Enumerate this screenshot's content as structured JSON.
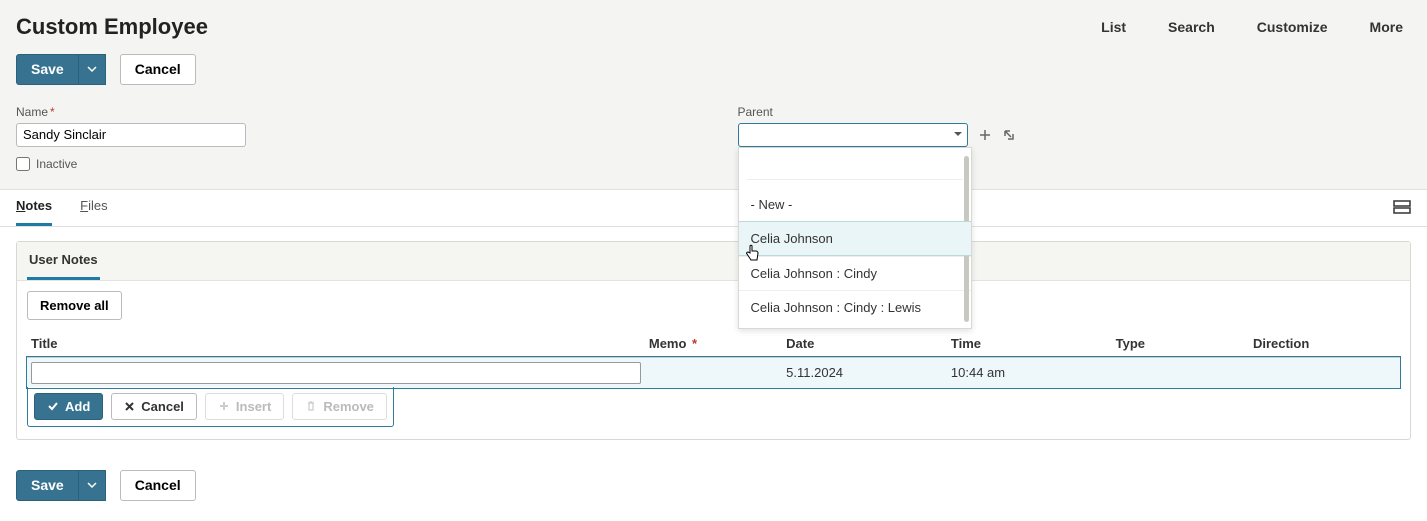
{
  "header": {
    "title": "Custom Employee",
    "topLinks": [
      "List",
      "Search",
      "Customize",
      "More"
    ]
  },
  "actions": {
    "save": "Save",
    "cancel": "Cancel"
  },
  "fields": {
    "name": {
      "label": "Name",
      "required": true,
      "value": "Sandy Sinclair"
    },
    "inactive": {
      "label": "Inactive",
      "checked": false
    },
    "parent": {
      "label": "Parent",
      "value": "",
      "options": [
        "- New -",
        "Celia Johnson",
        "Celia Johnson : Cindy",
        "Celia Johnson : Cindy : Lewis"
      ],
      "highlightIndex": 1
    }
  },
  "tabs": {
    "items": [
      {
        "label": "Notes",
        "underline": "N",
        "active": true
      },
      {
        "label": "Files",
        "underline": "F",
        "active": false
      }
    ]
  },
  "notes": {
    "subtab": "User Notes",
    "removeAll": "Remove all",
    "columns": {
      "title": "Title",
      "memo": "Memo",
      "memoRequired": true,
      "date": "Date",
      "time": "Time",
      "type": "Type",
      "direction": "Direction"
    },
    "row": {
      "title": "",
      "memo": "",
      "date": "5.11.2024",
      "time": "10:44 am",
      "type": "",
      "direction": ""
    },
    "rowActions": {
      "add": "Add",
      "cancel": "Cancel",
      "insert": "Insert",
      "remove": "Remove"
    }
  }
}
